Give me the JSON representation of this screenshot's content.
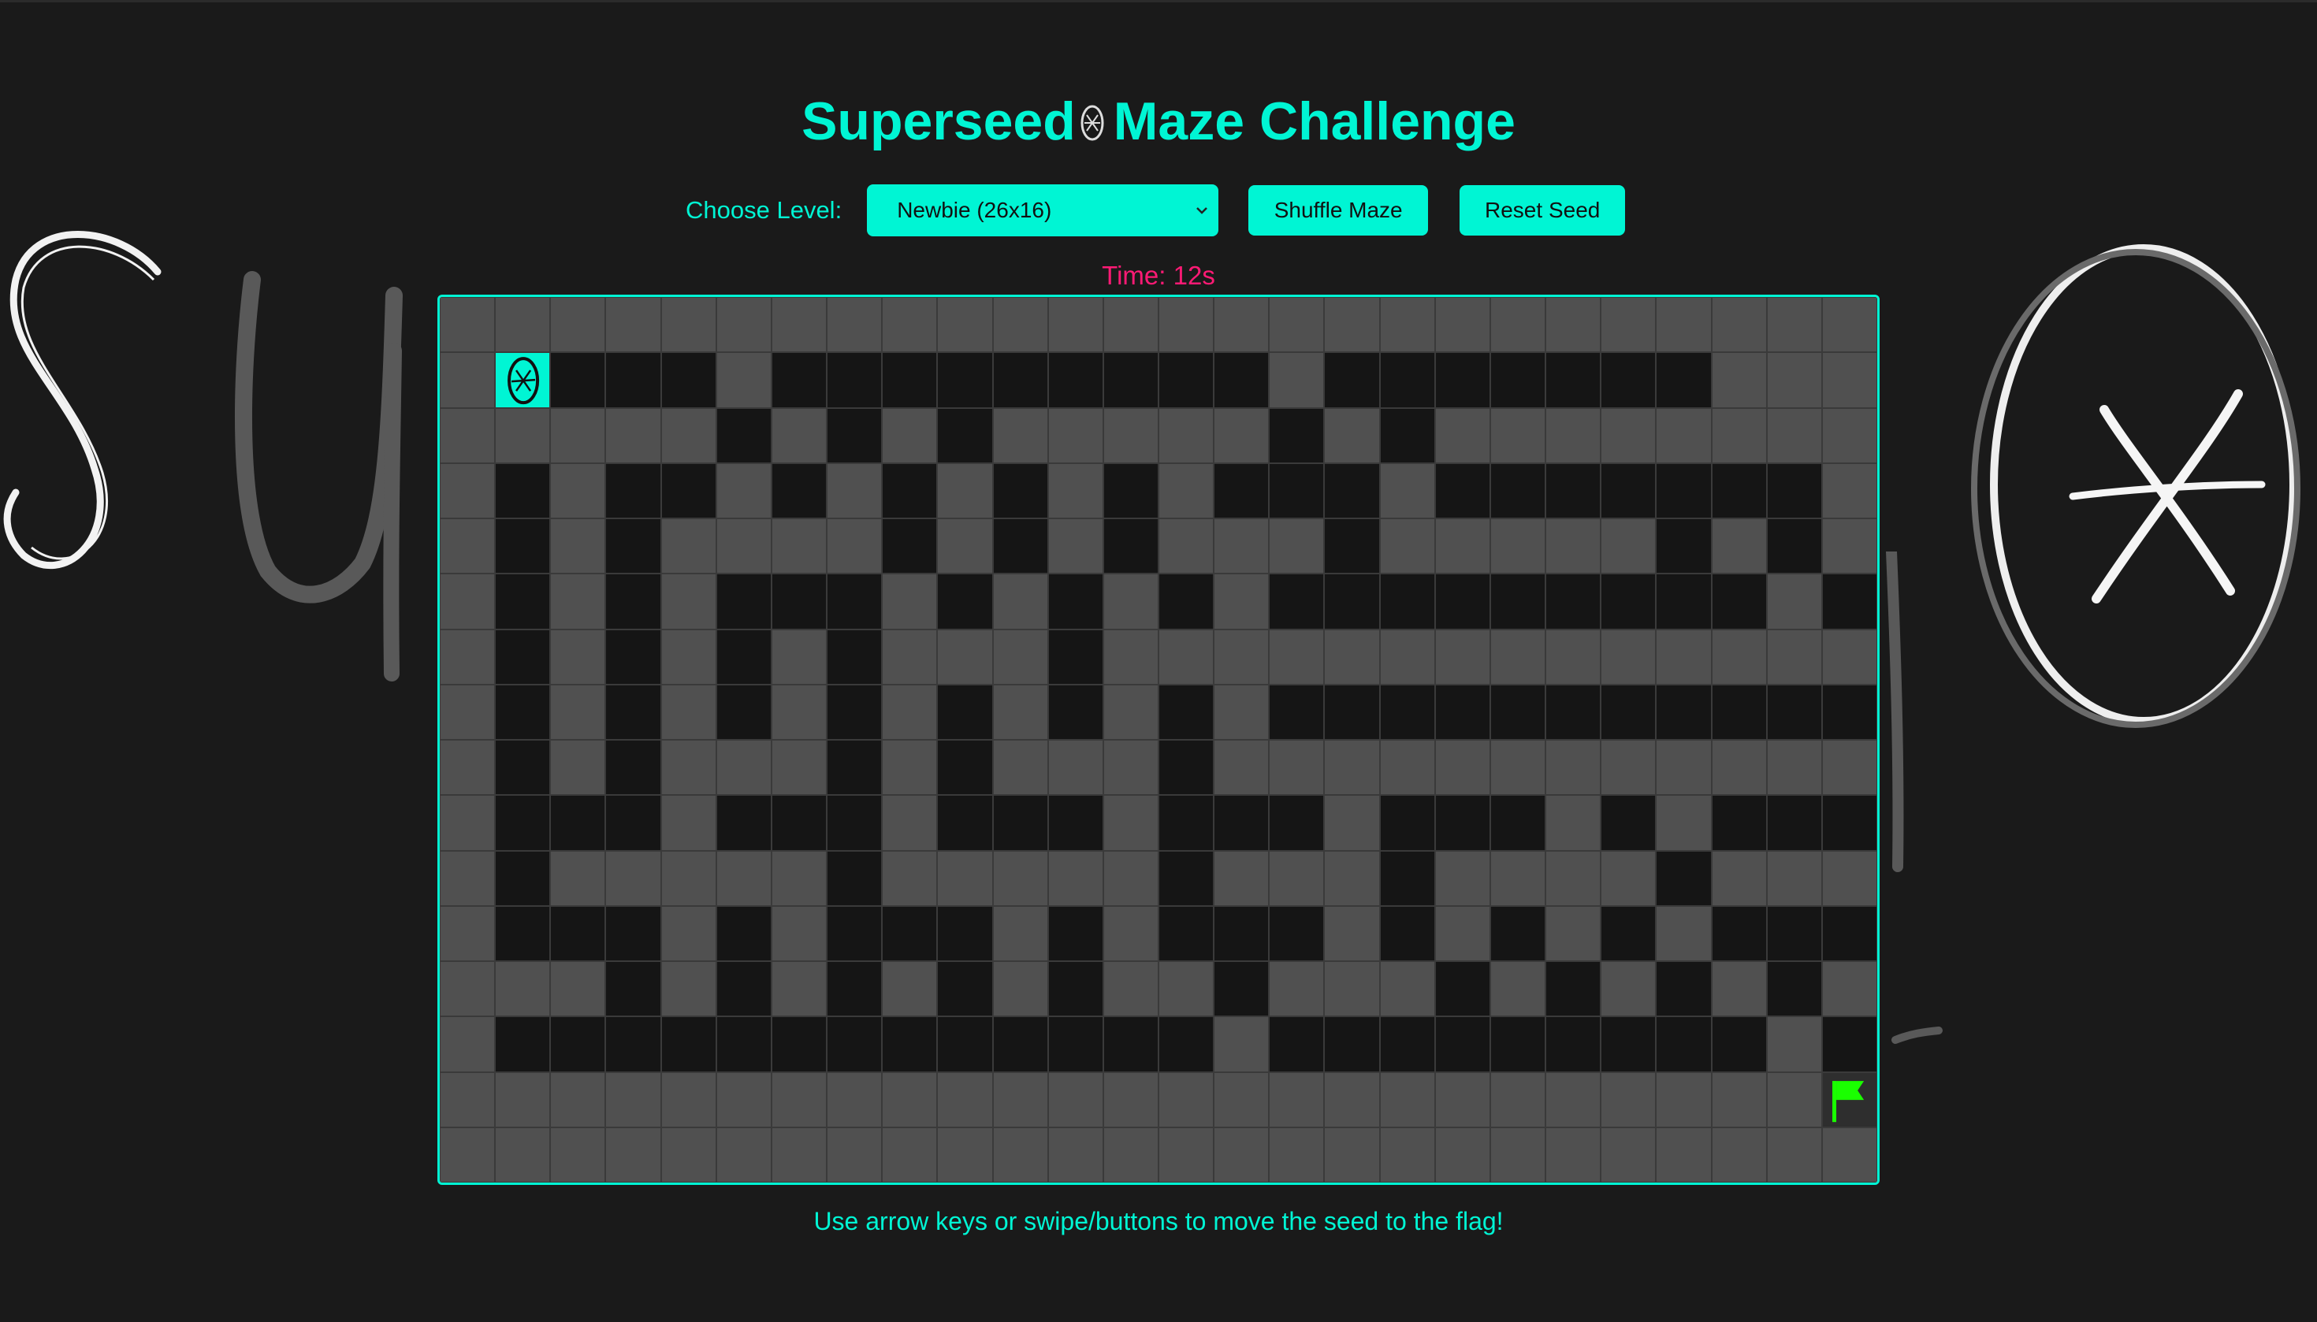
{
  "app": {
    "title": "Superseed",
    "title_suffix": "Maze Challenge",
    "title_icon": "seed-icon"
  },
  "controls": {
    "level_label": "Choose Level:",
    "level_selected": "Newbie (26x16)",
    "shuffle_label": "Shuffle Maze",
    "reset_label": "Reset Seed"
  },
  "timer": {
    "text": "Time: 12s"
  },
  "maze": {
    "columns": 26,
    "rows": 16,
    "legend": {
      "#": "wall",
      ".": "path",
      "S": "seed (player)",
      "G": "goal flag"
    },
    "grid": [
      "##########################",
      "#S...#.........#.......###",
      "#####.#.#.#####.#.#########",
      "#.#..#.#.#.#.#...#.......##",
      "#.#.####.#.#.###.#####.#.##",
      "#.#.#...#.#.#.#.........#.##",
      "#.#.#.#.###.##############.#",
      "#.#.#.#.#.#.#.#...........##",
      "#.#.###.#.###.############.#",
      "#...#...#...#...#...#.#...##",
      "#.#####.#####.###.####.###.#",
      "#...#.#...#.#...#.#.#.#...##",
      "###.#.#.#.#.##.###.#.#.#.##",
      "#.............#.........#.##",
      "#########################G##",
      "##########################"
    ],
    "seed_icon": "seed-icon",
    "goal_icon": "flag-icon",
    "accent_color": "#00f5d4",
    "goal_color": "#1aff00"
  },
  "hint": "Use arrow keys or swipe/buttons to move the seed to the flag!",
  "colors": {
    "background": "#1a1a1a",
    "accent": "#00f5d4",
    "timer": "#ff1a75",
    "wall": "#505050",
    "path": "#151515"
  }
}
